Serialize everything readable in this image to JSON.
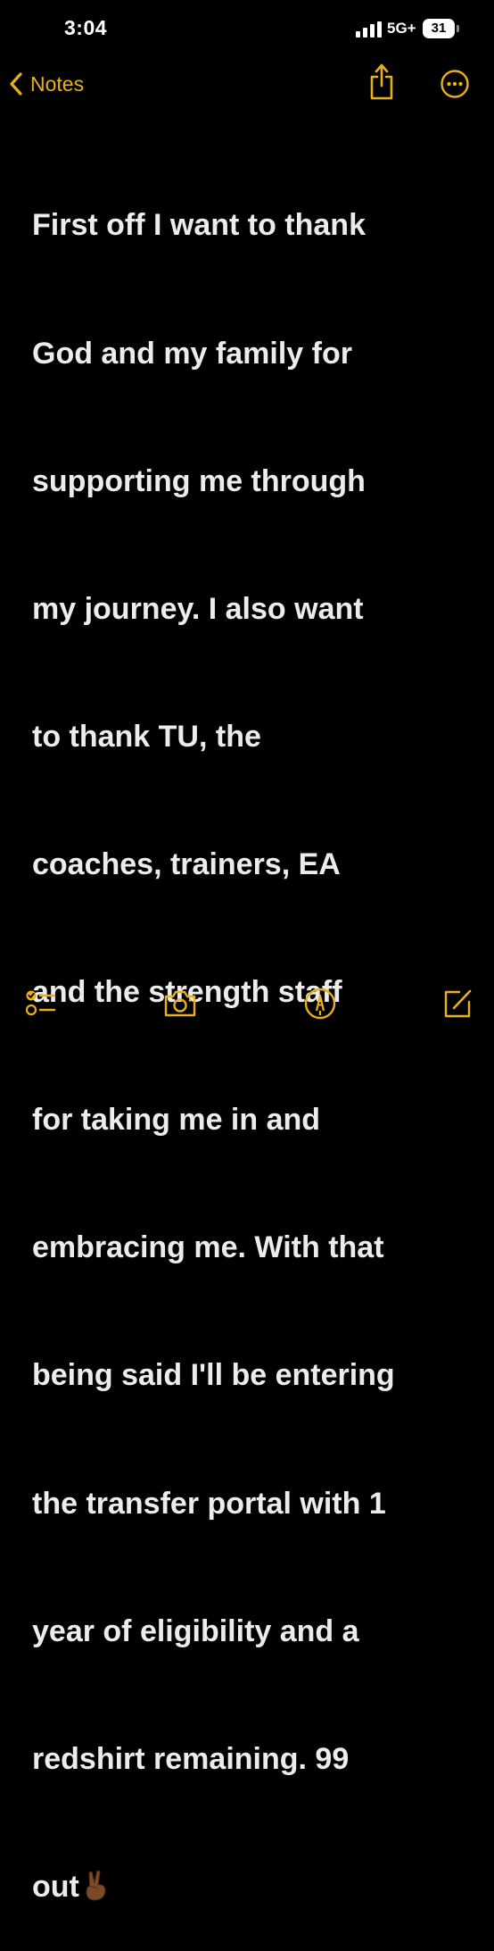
{
  "status_bar": {
    "time": "3:04",
    "network": "5G+",
    "battery": "31"
  },
  "nav": {
    "back_label": "Notes"
  },
  "note": {
    "lines": [
      "First off I want to thank",
      "God and my family for",
      "supporting me through",
      "my journey. I also want",
      "to thank TU, the",
      "coaches, trainers, EA",
      "and the strength staff",
      "for taking me in and",
      "embracing me. With that",
      "being said I'll be entering",
      "the transfer portal with 1",
      "year of eligibility and a",
      "redshirt remaining. 99",
      "out"
    ],
    "emoji": "victory-hand-medium-dark-skin-tone"
  },
  "toolbar": {
    "icons": [
      "checklist-icon",
      "camera-icon",
      "markup-pen-icon",
      "compose-icon"
    ]
  },
  "colors": {
    "accent": "#e8b01a",
    "background": "#000000",
    "text": "#ececec"
  }
}
